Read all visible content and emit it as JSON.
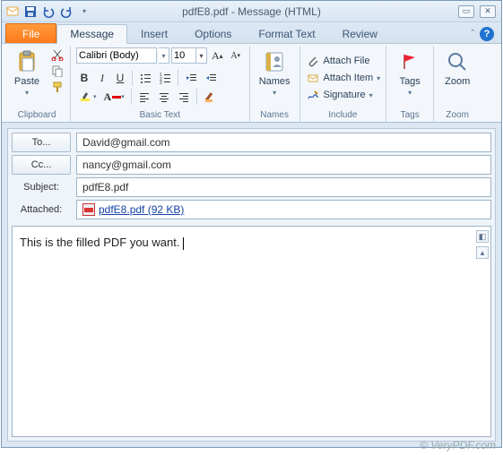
{
  "window": {
    "title": "pdfE8.pdf - Message (HTML)"
  },
  "tabs": {
    "file": "File",
    "message": "Message",
    "insert": "Insert",
    "options": "Options",
    "format_text": "Format Text",
    "review": "Review"
  },
  "ribbon": {
    "clipboard": {
      "label": "Clipboard",
      "paste": "Paste"
    },
    "basic_text": {
      "label": "Basic Text",
      "font_name": "Calibri (Body)",
      "font_size": "10"
    },
    "names": {
      "label": "Names",
      "btn": "Names"
    },
    "include": {
      "label": "Include",
      "attach_file": "Attach File",
      "attach_item": "Attach Item",
      "signature": "Signature"
    },
    "tags": {
      "label": "Tags",
      "btn": "Tags"
    },
    "zoom": {
      "label": "Zoom",
      "btn": "Zoom"
    }
  },
  "fields": {
    "to_btn": "To...",
    "to_value": "David@gmail.com",
    "cc_btn": "Cc...",
    "cc_value": "nancy@gmail.com",
    "subject_label": "Subject:",
    "subject_value": "pdfE8.pdf",
    "attached_label": "Attached:",
    "attached_name": "pdfE8.pdf (92 KB)"
  },
  "body": {
    "text": "This is the filled PDF you want."
  },
  "watermark": "© VeryPDF.com"
}
